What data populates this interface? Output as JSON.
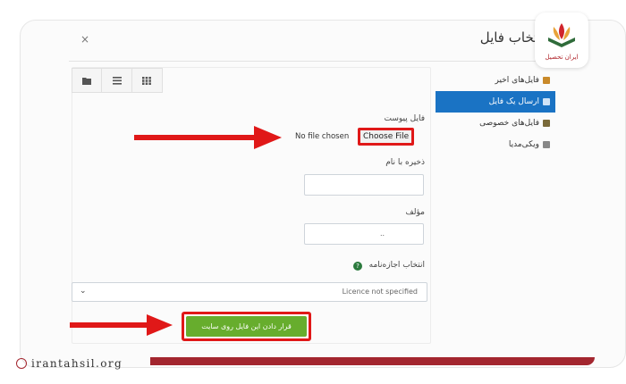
{
  "dialog": {
    "title": "انتخاب فایل",
    "close_glyph": "×"
  },
  "toolbar": {
    "buttons": [
      {
        "icon": "folder-icon"
      },
      {
        "icon": "list-icon"
      },
      {
        "icon": "grid-icon"
      }
    ]
  },
  "sidebar": {
    "items": [
      {
        "label": "فایل‌های اخیر",
        "icon": "recent-files-icon",
        "active": false
      },
      {
        "label": "ارسال یک فایل",
        "icon": "upload-icon",
        "active": true
      },
      {
        "label": "فایل‌های خصوصی",
        "icon": "private-files-icon",
        "active": false
      },
      {
        "label": "ویکی‌مدیا",
        "icon": "wikimedia-icon",
        "active": false
      }
    ]
  },
  "form": {
    "attachment_label": "فایل پیوست",
    "no_file_text": "No file chosen",
    "choose_file_label": "Choose File",
    "save_as_label": "ذخیره با نام",
    "save_as_value": "",
    "author_label": "مؤلف",
    "author_value": "..",
    "license_label": "انتخاب اجازه‌نامه",
    "license_selected": "Licence not specified",
    "upload_button_label": "قرار دادن این فایل روی سایت"
  },
  "colors": {
    "accent_blue": "#1a73c4",
    "highlight_red": "#e01818",
    "upload_green": "#67ad2d",
    "brand_red": "#a3262f"
  },
  "branding": {
    "logo_text": "ایران تحصیل",
    "site_url": "irantahsil.org"
  }
}
